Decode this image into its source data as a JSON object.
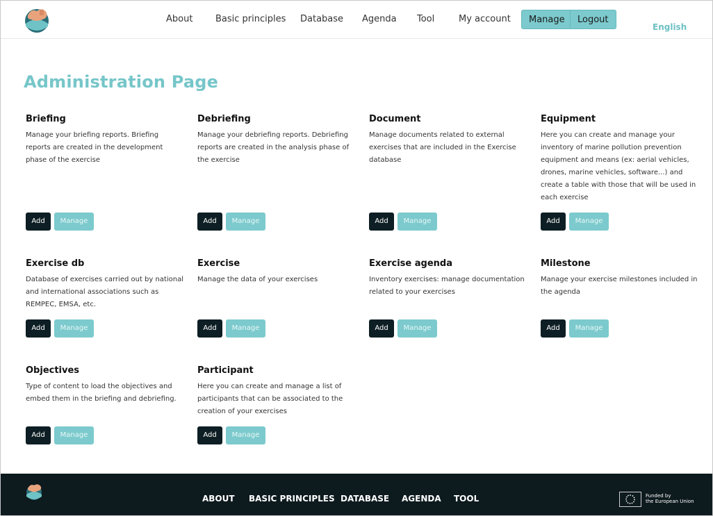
{
  "header": {
    "nav": [
      "About",
      "Basic principles",
      "Database",
      "Agenda",
      "Tool",
      "My account"
    ],
    "manage_label": "Manage",
    "logout_label": "Logout",
    "language": "English"
  },
  "page_title": "Administration Page",
  "cards": [
    {
      "title": "Briefing",
      "desc": "Manage your briefing reports. Briefing reports are created in the development phase of the exercise"
    },
    {
      "title": "Debriefing",
      "desc": "Manage your debriefing reports. Debriefing reports are created in the analysis phase of the exercise"
    },
    {
      "title": "Document",
      "desc": "Manage documents related to external exercises that are included in the Exercise database"
    },
    {
      "title": "Equipment",
      "desc": "Here you can create and manage your inventory of marine pollution prevention equipment and means (ex: aerial vehicles, drones, marine vehicles, software...) and create a table with those that will be used in each exercise"
    },
    {
      "title": "Exercise db",
      "desc": "Database of exercises carried out by national and international associations such as REMPEC, EMSA, etc."
    },
    {
      "title": "Exercise",
      "desc": "Manage the data of your exercises"
    },
    {
      "title": "Exercise agenda",
      "desc": "Inventory exercises: manage documentation related to your exercises"
    },
    {
      "title": "Milestone",
      "desc": "Manage your exercise milestones included in the agenda"
    },
    {
      "title": "Objectives",
      "desc": "Type of content to load the objectives and embed them in the briefing and debriefing."
    },
    {
      "title": "Participant",
      "desc": "Here you can create and manage a list of participants that can be associated to the creation of your exercises"
    }
  ],
  "buttons": {
    "add": "Add",
    "manage": "Manage"
  },
  "footer": {
    "links": [
      "ABOUT",
      "BASIC PRINCIPLES",
      "DATABASE",
      "AGENDA",
      "TOOL"
    ],
    "eu_line1": "Funded by",
    "eu_line2": "the European Union"
  },
  "colors": {
    "accent": "#7ccacd",
    "dark": "#0d1e24",
    "footer": "#0d1a1e"
  }
}
